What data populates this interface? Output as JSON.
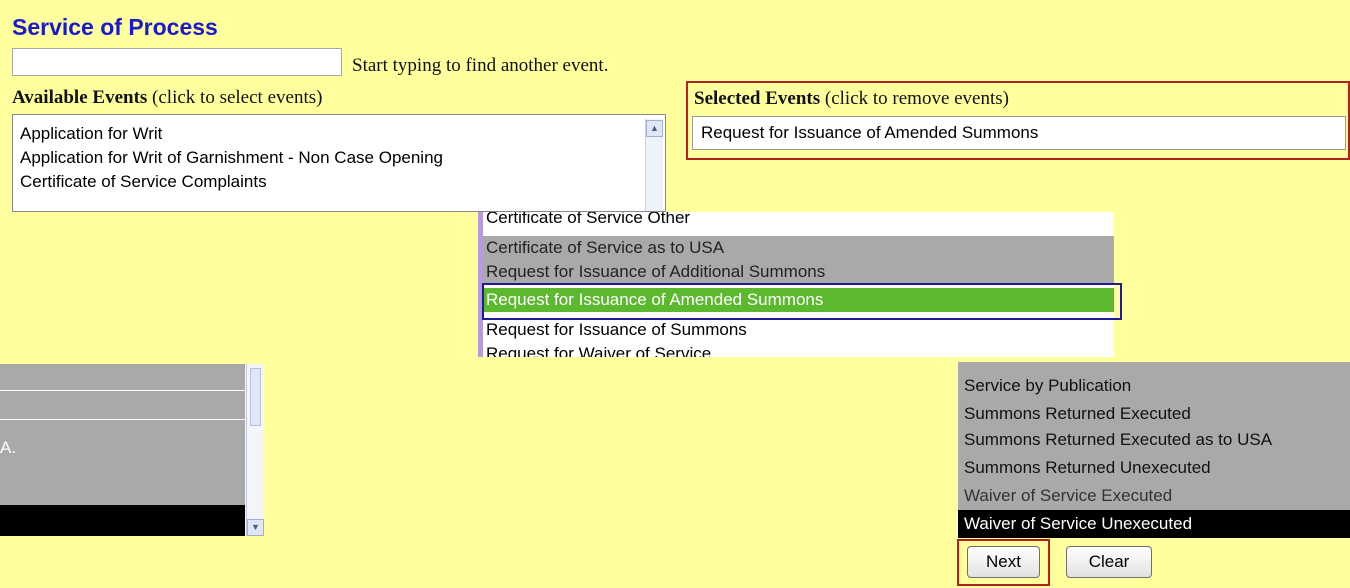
{
  "page": {
    "title": "Service of Process",
    "search_hint": "Start typing to find another event."
  },
  "available": {
    "label_bold": "Available Events",
    "label_rest": " (click to select events)",
    "items": [
      "Application for Writ",
      "Application for Writ of Garnishment - Non Case Opening",
      "Certificate of Service Complaints"
    ]
  },
  "selected": {
    "label_bold": "Selected Events",
    "label_rest": " (click to remove events)",
    "items": [
      "Request for Issuance of Amended Summons"
    ]
  },
  "zoom_list": {
    "items": [
      "Certificate of Service Other",
      "Certificate of Service as to USA",
      "Request for Issuance of Additional Summons",
      "Request for Issuance of Amended Summons",
      "Request for Issuance of Summons",
      "Request for Waiver of Service"
    ],
    "highlighted": "Request for Issuance of Amended Summons"
  },
  "left_fragment": {
    "text": "A."
  },
  "right_list": {
    "items": [
      "Service by Publication",
      "Summons Returned Executed",
      "Summons Returned Executed as to USA",
      "Summons Returned Unexecuted",
      "Waiver of Service Executed",
      "Waiver of Service Unexecuted"
    ]
  },
  "buttons": {
    "next": "Next",
    "clear": "Clear"
  },
  "colors": {
    "background": "#ffff9e",
    "title": "#1a1acc",
    "selection": "#5cb82e",
    "callout": "#b22020"
  }
}
